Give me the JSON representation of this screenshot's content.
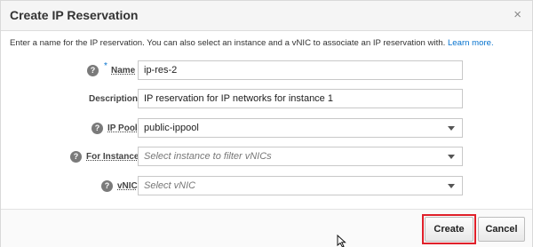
{
  "dialog": {
    "title": "Create IP Reservation",
    "close_glyph": "×",
    "intro_text": "Enter a name for the IP reservation. You can also select an instance and a vNIC to associate an IP reservation with.",
    "learn_more": "Learn more."
  },
  "form": {
    "name": {
      "label": "Name",
      "required_mark": "*",
      "value": "ip-res-2"
    },
    "description": {
      "label": "Description",
      "value": "IP reservation for IP networks for instance 1"
    },
    "ip_pool": {
      "label": "IP Pool",
      "value": "public-ippool"
    },
    "for_instance": {
      "label": "For Instance",
      "placeholder": "Select instance to filter vNICs"
    },
    "vnic": {
      "label": "vNIC",
      "placeholder": "Select vNIC"
    },
    "help_glyph": "?"
  },
  "footer": {
    "create_label": "Create",
    "cancel_label": "Cancel"
  },
  "icons": [
    "help-icon",
    "close-icon",
    "dropdown-caret-icon",
    "mouse-cursor-icon"
  ],
  "colors": {
    "accent": "#0572ce",
    "highlight": "#e0202a",
    "header_bg": "#f5f5f5"
  }
}
